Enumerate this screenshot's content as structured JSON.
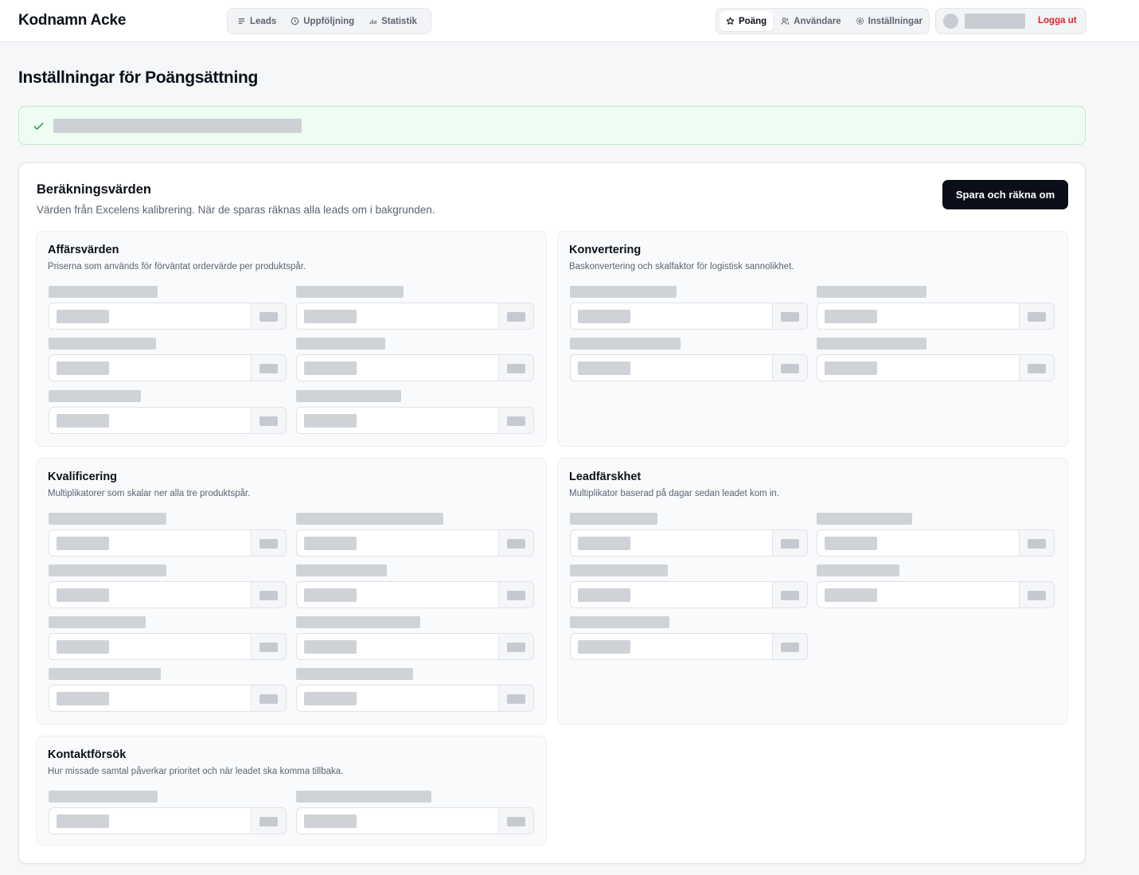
{
  "header": {
    "brand": "Kodnamn Acke",
    "nav_left": [
      {
        "label": "Leads",
        "icon": "list-icon"
      },
      {
        "label": "Uppföljning",
        "icon": "clock-icon"
      },
      {
        "label": "Statistik",
        "icon": "bar-chart-icon"
      }
    ],
    "nav_right": [
      {
        "label": "Poäng",
        "icon": "star-icon",
        "active": true
      },
      {
        "label": "Användare",
        "icon": "users-icon"
      },
      {
        "label": "Inställningar",
        "icon": "gear-icon"
      }
    ],
    "logout_label": "Logga ut"
  },
  "page": {
    "title": "Inställningar för Poängsättning"
  },
  "colors": {
    "accent": "#0b0f19",
    "success_bg": "#effcf2",
    "success_icon": "#16a34a",
    "logout": "#dc2626"
  },
  "card": {
    "title": "Beräkningsvärden",
    "subtitle": "Värden från Excelens kalibrering. När de sparas räknas alla leads om i bakgrunden.",
    "save_button": "Spara och räkna om"
  },
  "sections": [
    {
      "key": "affarsvarden",
      "title": "Affärsvärden",
      "subtitle": "Priserna som används för förväntat ordervärde per produktspår."
    },
    {
      "key": "konvertering",
      "title": "Konvertering",
      "subtitle": "Baskonvertering och skalfaktor för logistisk sannolikhet."
    },
    {
      "key": "kvalificering",
      "title": "Kvalificering",
      "subtitle": "Multiplikatorer som skalar ner alla tre produktspår."
    },
    {
      "key": "leadfarskhet",
      "title": "Leadfärskhet",
      "subtitle": "Multiplikator baserad på dagar sedan leadet kom in."
    },
    {
      "key": "kontaktforsok",
      "title": "Kontaktförsök",
      "subtitle": "Hur missade samtal påverkar prioritet och när leadet ska komma tillbaka."
    }
  ]
}
